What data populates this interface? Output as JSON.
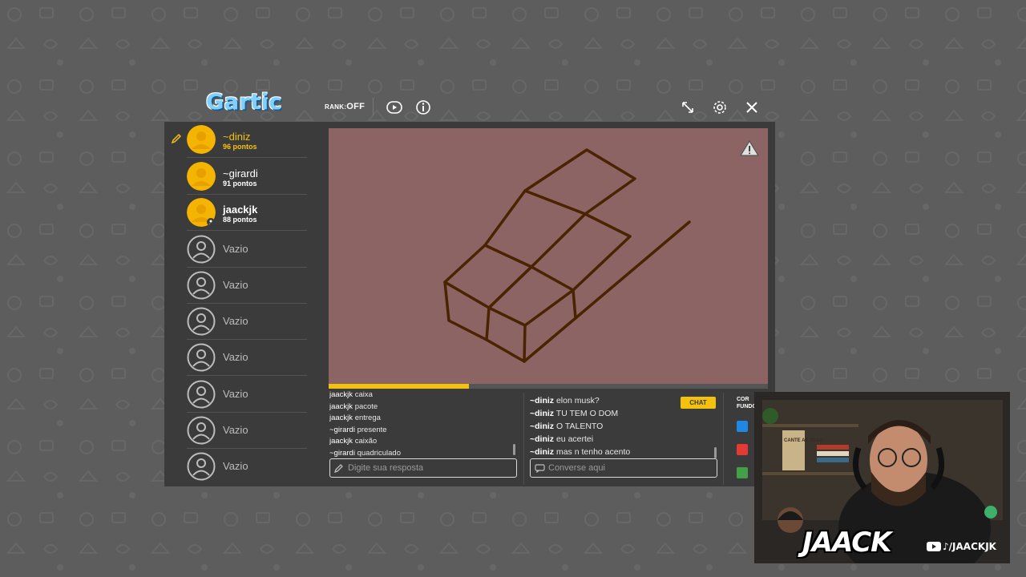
{
  "header": {
    "logo_text": "Gartic",
    "rank_label": "RANK:",
    "rank_value": "OFF"
  },
  "players": [
    {
      "name": "~diniz",
      "points": "96 pontos",
      "status": "drawing"
    },
    {
      "name": "~girardi",
      "points": "91 pontos",
      "status": "normal"
    },
    {
      "name": "jaackjk",
      "points": "88 pontos",
      "status": "me"
    },
    {
      "name": "Vazio"
    },
    {
      "name": "Vazio"
    },
    {
      "name": "Vazio"
    },
    {
      "name": "Vazio"
    },
    {
      "name": "Vazio"
    },
    {
      "name": "Vazio"
    },
    {
      "name": "Vazio"
    }
  ],
  "round_progress": 0.32,
  "answers": [
    {
      "user": "jaackjk",
      "text": "caixa"
    },
    {
      "user": "jaackjk",
      "text": "pacote"
    },
    {
      "user": "jaackjk",
      "text": "entrega"
    },
    {
      "user": "~girardi",
      "text": "presente"
    },
    {
      "user": "jaackjk",
      "text": "caixão"
    },
    {
      "user": "~girardi",
      "text": "quadriculado"
    }
  ],
  "answer_input": {
    "placeholder": "Digite sua resposta"
  },
  "chat": {
    "badge": "CHAT",
    "messages": [
      {
        "user": "~diniz",
        "text": "elon musk?"
      },
      {
        "user": "~diniz",
        "text": "TU TEM O DOM"
      },
      {
        "user": "~diniz",
        "text": "O TALENTO"
      },
      {
        "user": "~diniz",
        "text": "eu acertei"
      },
      {
        "user": "~diniz",
        "text": "mas n tenho acento"
      }
    ],
    "input_placeholder": "Converse aqui"
  },
  "colors_panel": {
    "label_line1": "COR",
    "label_line2": "FUNDO",
    "swatches": [
      "#1e88e5",
      "#e53935",
      "#43a047"
    ]
  },
  "canvas": {
    "background": "#8c6464",
    "stroke": "#4a2300"
  },
  "webcam": {
    "brand": "JAACK",
    "handle": "/JAACKJK",
    "book_text": "CANTE AS TUAS"
  }
}
